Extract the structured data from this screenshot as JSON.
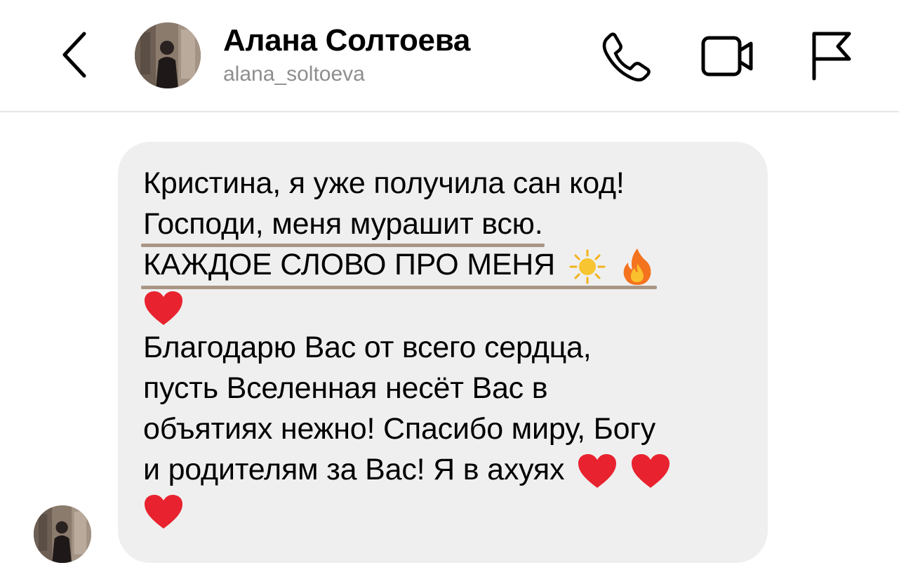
{
  "header": {
    "contact_name": "Алана Солтоева",
    "contact_handle": "alana_soltoeva",
    "icons": [
      "back-chevron-icon",
      "phone-icon",
      "video-call-icon",
      "flag-icon"
    ]
  },
  "message": {
    "lines": {
      "l1": "Кристина, я уже получила сан код!",
      "l2": "Господи, меня мурашит всю.",
      "l3": "КАЖДОЕ СЛОВО ПРО МЕНЯ",
      "l5": "Благодарю Вас от всего сердца,",
      "l6": "пусть Вселенная несёт Вас в",
      "l7": "объятиях нежно! Спасибо миру, Богу",
      "l8": "и родителям за Вас! Я в ахуях"
    },
    "emojis": [
      "sun-emoji",
      "fire-emoji",
      "red-heart-emoji"
    ],
    "highlight_color": "#a89685",
    "bubble_color": "#efefef"
  },
  "colors": {
    "secondary_text": "#8e8e8e",
    "divider": "#e6e6e6",
    "heart": "#e8232f"
  }
}
